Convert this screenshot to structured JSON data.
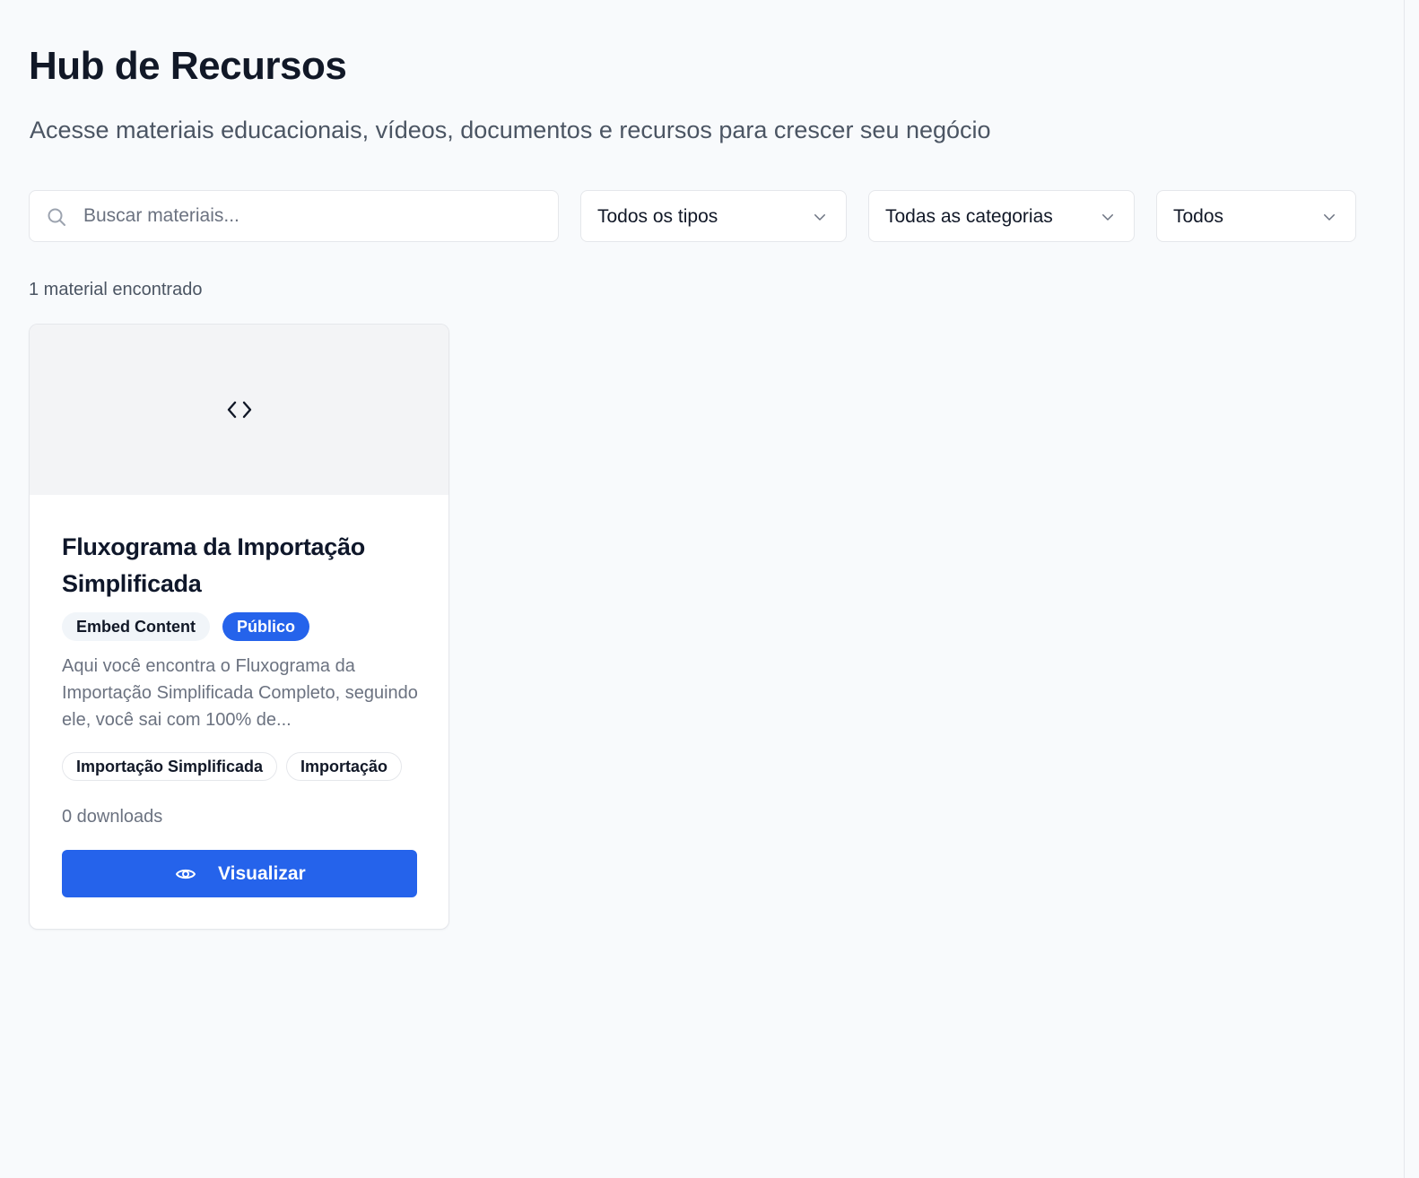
{
  "header": {
    "title": "Hub de Recursos",
    "subtitle": "Acesse materiais educacionais, vídeos, documentos e recursos para crescer seu negócio"
  },
  "filters": {
    "search": {
      "placeholder": "Buscar materiais...",
      "value": "",
      "icon": "search-icon"
    },
    "type_select": {
      "value": "Todos os tipos",
      "icon": "chevron-down-icon"
    },
    "category_select": {
      "value": "Todas as categorias",
      "icon": "chevron-down-icon"
    },
    "visibility_select": {
      "value": "Todos",
      "icon": "chevron-down-icon"
    }
  },
  "results": {
    "count_label": "1 material encontrado",
    "items": [
      {
        "thumbnail_icon": "code-icon",
        "title": "Fluxograma da Importação Simplificada",
        "type_badge": "Embed Content",
        "visibility_badge": "Público",
        "description": "Aqui você encontra o Fluxograma da Importação Simplificada Completo, seguindo ele, você sai com 100% de...",
        "tags": [
          "Importação Simplificada",
          "Importação"
        ],
        "downloads_label": "0 downloads",
        "action_label": "Visualizar",
        "action_icon": "eye-icon"
      }
    ]
  },
  "colors": {
    "background": "#f8fafc",
    "primary": "#2563eb",
    "text_primary": "#111827",
    "text_secondary": "#4b5563",
    "text_muted": "#6b7280",
    "border": "#e5e7eb",
    "thumbnail_bg": "#f3f4f6"
  }
}
